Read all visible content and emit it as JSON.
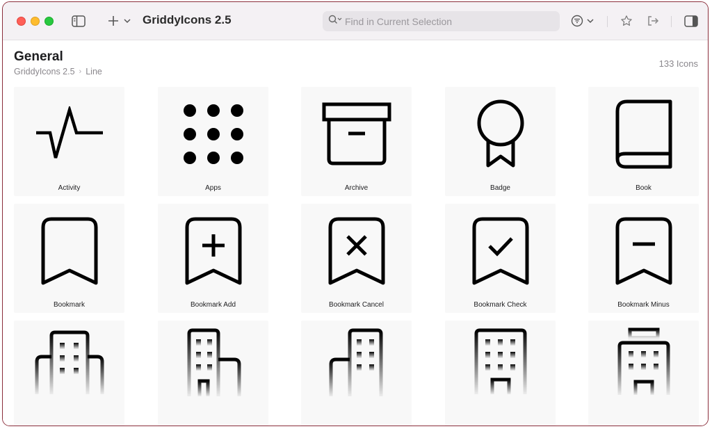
{
  "window": {
    "title": "GriddyIcons 2.5",
    "search_placeholder": "Find in Current Selection",
    "colors": {
      "close": "#ff5f57",
      "minimize": "#febc2e",
      "zoom": "#28c840"
    }
  },
  "toolbar": {
    "icons": [
      "sidebar-toggle-icon",
      "plus-icon",
      "chevron-down-icon",
      "search-icon",
      "filter-icon",
      "star-icon",
      "share-icon",
      "inspector-icon"
    ]
  },
  "header": {
    "title": "General",
    "breadcrumb": [
      "GriddyIcons 2.5",
      "Line"
    ],
    "breadcrumb_separator": "›",
    "count": "133 Icons"
  },
  "icons": [
    {
      "label": "Activity",
      "icon": "activity-icon"
    },
    {
      "label": "Apps",
      "icon": "apps-icon"
    },
    {
      "label": "Archive",
      "icon": "archive-icon"
    },
    {
      "label": "Badge",
      "icon": "badge-icon"
    },
    {
      "label": "Book",
      "icon": "book-icon"
    },
    {
      "label": "Bookmark",
      "icon": "bookmark-icon"
    },
    {
      "label": "Bookmark Add",
      "icon": "bookmark-add-icon"
    },
    {
      "label": "Bookmark Cancel",
      "icon": "bookmark-cancel-icon"
    },
    {
      "label": "Bookmark Check",
      "icon": "bookmark-check-icon"
    },
    {
      "label": "Bookmark Minus",
      "icon": "bookmark-minus-icon"
    },
    {
      "label": "",
      "icon": "building-icon"
    },
    {
      "label": "",
      "icon": "building-icon"
    },
    {
      "label": "",
      "icon": "building-icon"
    },
    {
      "label": "",
      "icon": "building-icon"
    },
    {
      "label": "",
      "icon": "building-icon"
    }
  ]
}
